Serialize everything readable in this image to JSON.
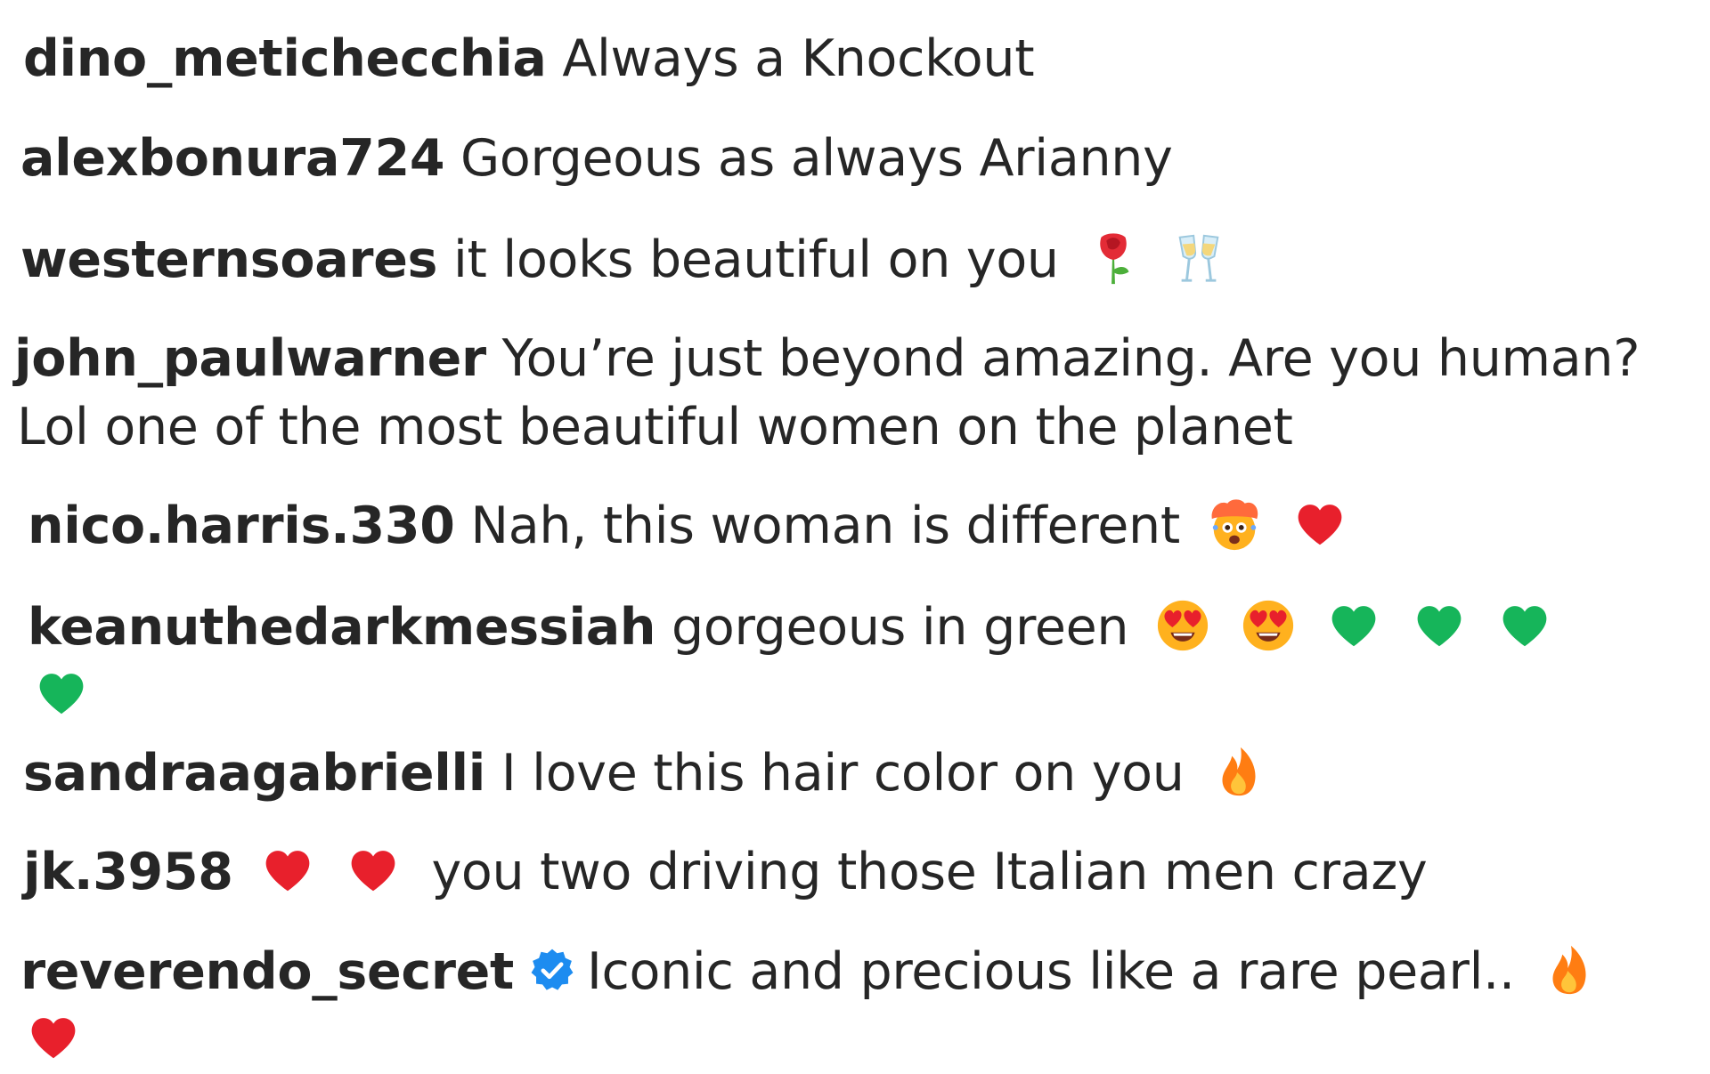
{
  "comments": [
    {
      "username": "dino_metichecchia",
      "text": "Always a Knockout"
    },
    {
      "username": "alexbonura724",
      "text": "Gorgeous as always Arianny"
    },
    {
      "username": "westernsoares",
      "text": "it looks beautiful on you",
      "emojis": [
        "rose-icon",
        "clinking-glasses-icon"
      ]
    },
    {
      "username": "john_paulwarner",
      "text": "You’re just beyond amazing. Are you human?",
      "text_line2": "Lol one of the most beautiful women on the planet"
    },
    {
      "username": "nico.harris.330",
      "text": "Nah, this woman is different",
      "emojis": [
        "exploding-head-icon",
        "red-heart-icon"
      ]
    },
    {
      "username": "keanuthedarkmessiah",
      "text": "gorgeous in green",
      "emojis": [
        "heart-eyes-icon",
        "heart-eyes-icon",
        "green-heart-icon",
        "green-heart-icon",
        "green-heart-icon",
        "green-heart-icon"
      ]
    },
    {
      "username": "sandraagabrielli",
      "text": "I love this hair color on you",
      "emojis": [
        "fire-icon"
      ]
    },
    {
      "username": "jk.3958",
      "text": "you two driving those Italian men crazy",
      "emojis": [
        "red-heart-icon",
        "red-heart-icon"
      ]
    },
    {
      "username": "reverendo_secret",
      "verified": true,
      "text": "Iconic and precious like a rare pearl..",
      "emojis": [
        "fire-icon",
        "red-heart-icon"
      ]
    }
  ],
  "colors": {
    "text": "#262626",
    "red_heart": "#e8202c",
    "green_heart": "#16b55a",
    "fire": "#ff8a1c",
    "verified_blue": "#1d8cf0",
    "emoji_face": "#ffb11e"
  }
}
